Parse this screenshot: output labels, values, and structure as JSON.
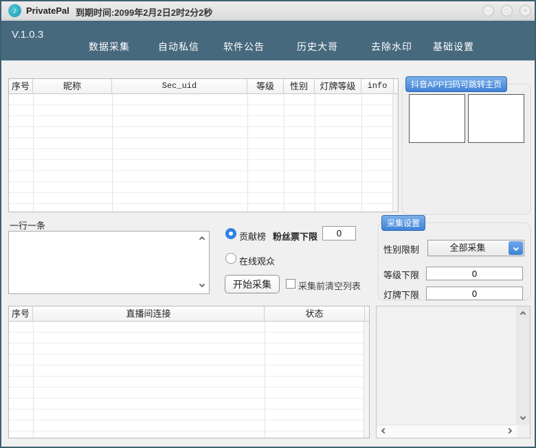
{
  "colors": {
    "accent_blue": "#4a90d9",
    "nav_teal": "#47697e",
    "window_border": "#3c5f6d",
    "logo_teal": "#2aa9bd"
  },
  "titlebar": {
    "app_name": "PrivatePal",
    "expiry": "到期时间:2099年2月2日2时2分2秒",
    "logo_glyph": "♪",
    "minimize_glyph": "—",
    "maximize_glyph": "◻",
    "close_glyph": "✕"
  },
  "navbar": {
    "version": "V.1.0.3",
    "items": [
      {
        "label": "数据采集"
      },
      {
        "label": "自动私信"
      },
      {
        "label": "软件公告"
      },
      {
        "label": "历史大哥"
      },
      {
        "label": "去除水印"
      },
      {
        "label": "基础设置"
      }
    ]
  },
  "user_table": {
    "headers": [
      "序号",
      "昵称",
      "Sec_uid",
      "等级",
      "性别",
      "灯牌等级",
      "info"
    ],
    "rows": []
  },
  "qr_panel": {
    "title": "抖音APP扫码可跳转主页"
  },
  "input_section": {
    "label": "一行一条",
    "value": ""
  },
  "collect_controls": {
    "contribution_radio_label": "贡献榜",
    "contribution_selected": true,
    "fan_ticket_label": "粉丝票下限",
    "fan_ticket_value": "0",
    "online_radio_label": "在线观众",
    "online_selected": false,
    "start_button_label": "开始采集",
    "clear_checkbox_label": "采集前清空列表",
    "clear_checked": false
  },
  "settings_panel": {
    "title": "采集设置",
    "gender_label": "性别限制",
    "gender_value": "全部采集",
    "level_label": "等级下限",
    "level_value": "0",
    "badge_label": "灯牌下限",
    "badge_value": "0"
  },
  "room_table": {
    "headers": [
      "序号",
      "直播间连接",
      "状态"
    ],
    "rows": []
  },
  "log_panel": {
    "content": ""
  }
}
